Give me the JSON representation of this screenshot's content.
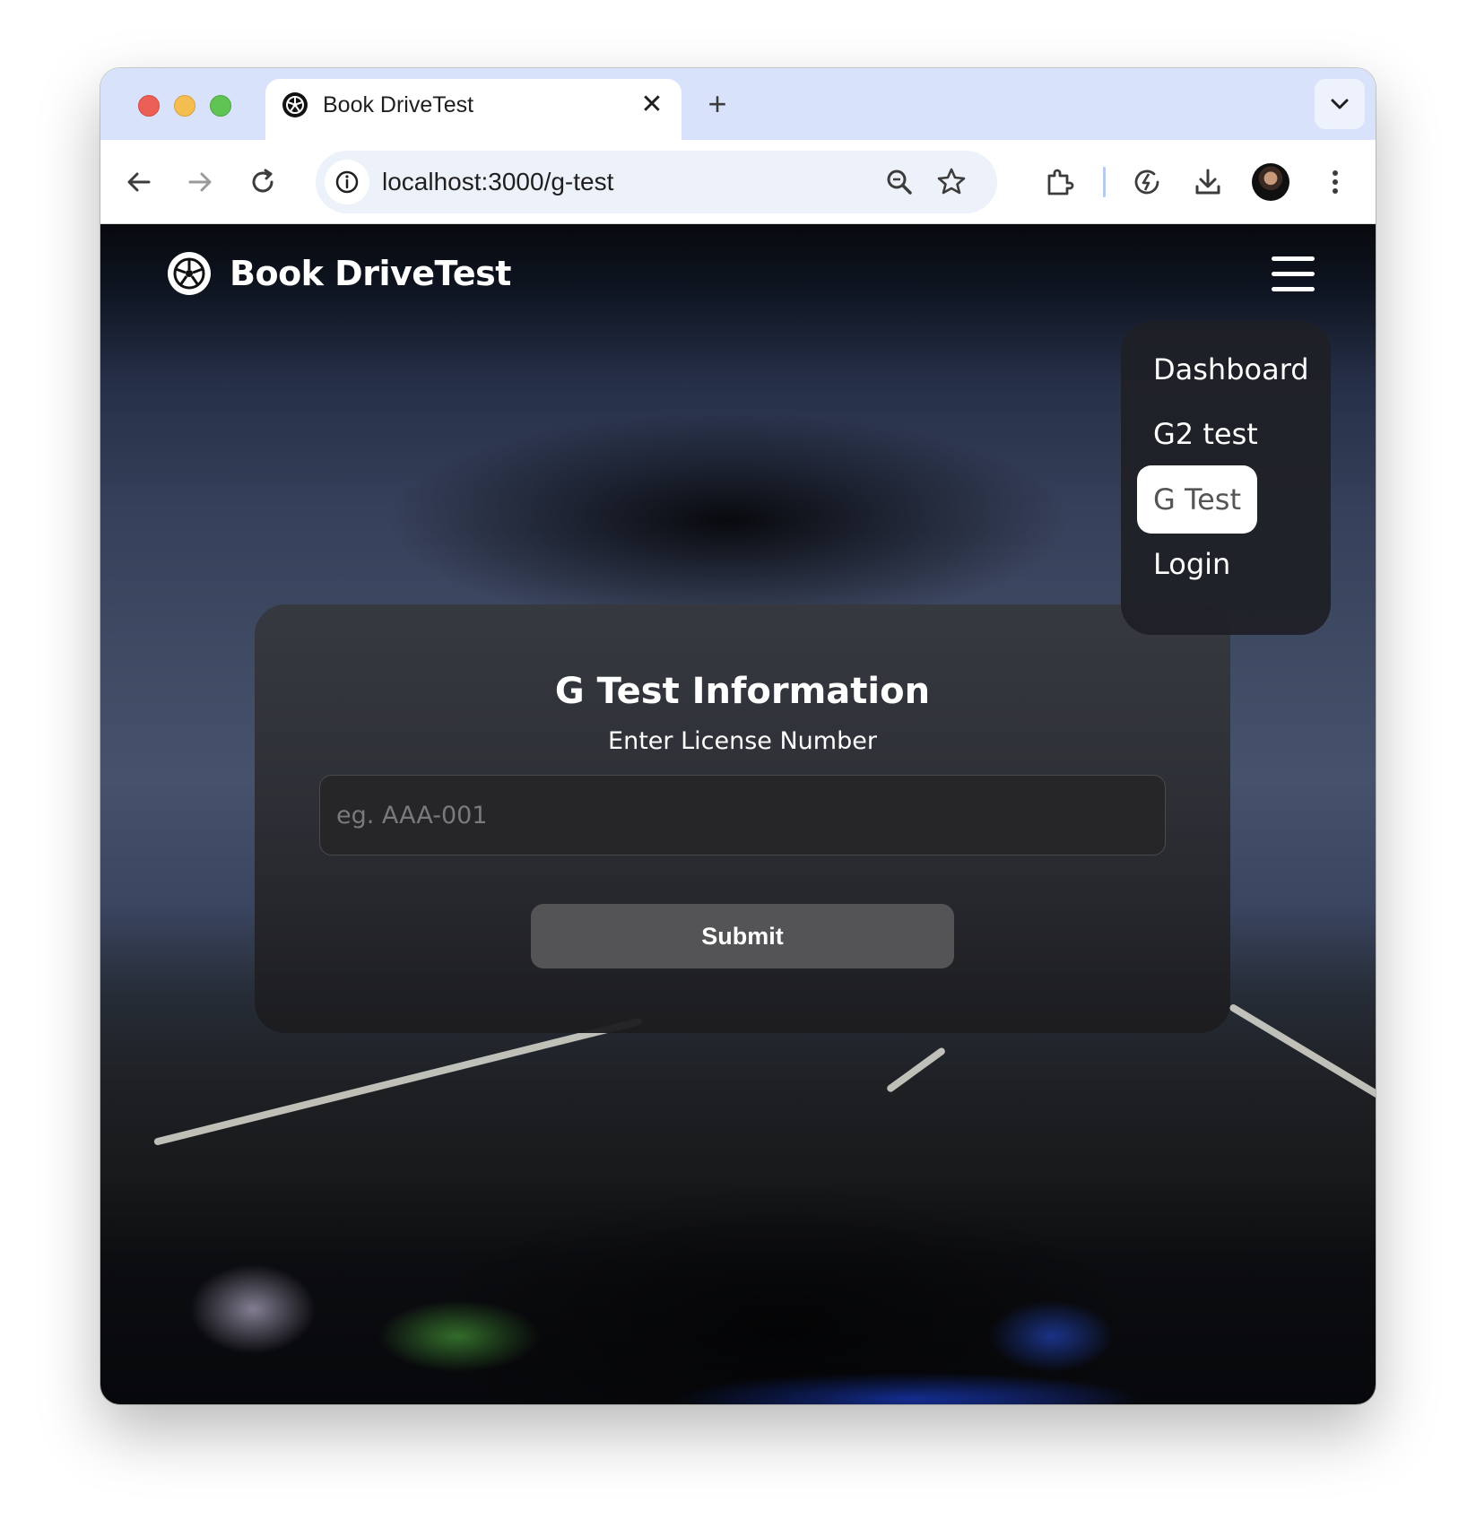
{
  "browser": {
    "tab": {
      "title": "Book DriveTest",
      "close_glyph": "✕"
    },
    "new_tab_glyph": "+",
    "url": "localhost:3000/g-test",
    "icons": [
      "back-icon",
      "forward-icon",
      "reload-icon",
      "site-info-icon",
      "zoom-icon",
      "bookmark-star-icon",
      "extensions-icon",
      "performance-icon",
      "download-icon",
      "profile-avatar",
      "more-menu-icon",
      "tab-search-chevron-icon"
    ]
  },
  "nav": {
    "brand": "Book DriveTest",
    "menu_icon": "hamburger-icon"
  },
  "menu": {
    "items": [
      {
        "label": "Dashboard",
        "active": false
      },
      {
        "label": "G2 test",
        "active": false
      },
      {
        "label": "G Test",
        "active": true
      },
      {
        "label": "Login",
        "active": false
      }
    ]
  },
  "form": {
    "title": "G Test Information",
    "subtitle": "Enter License Number",
    "license_value": "",
    "license_placeholder": "eg. AAA-001",
    "submit_label": "Submit"
  },
  "colors": {
    "tabstrip": "#d8e3fb",
    "card": "#2e2f34",
    "submit": "#545456",
    "active_menu_bg": "#ffffff"
  }
}
